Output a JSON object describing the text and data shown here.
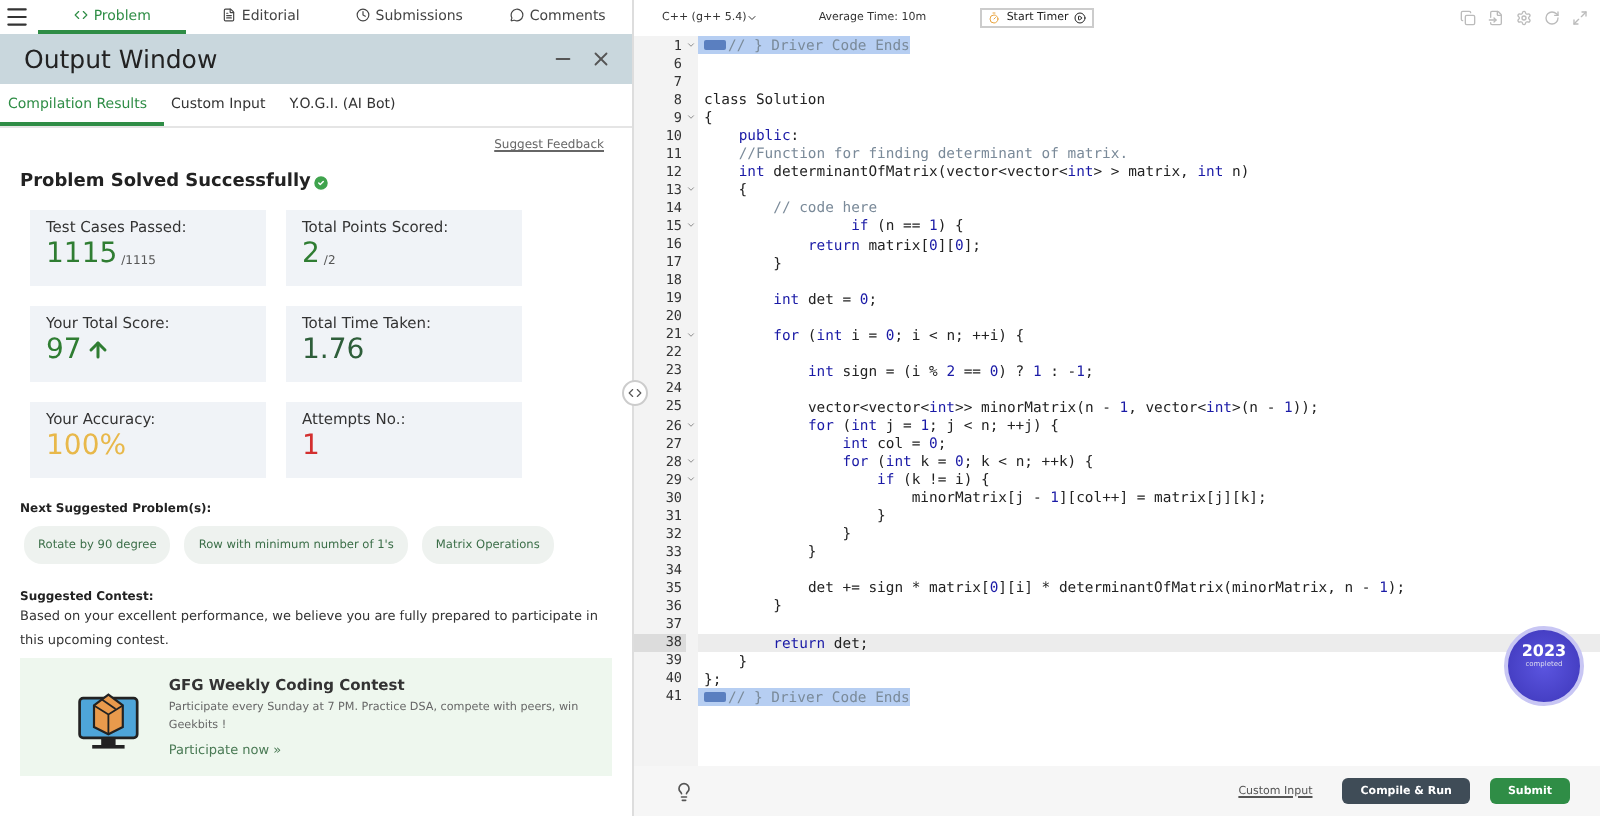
{
  "nav_tabs": [
    {
      "label": "Problem",
      "selected": true
    },
    {
      "label": "Editorial",
      "selected": false
    },
    {
      "label": "Submissions",
      "selected": false
    },
    {
      "label": "Comments",
      "selected": false
    }
  ],
  "output_window": {
    "title": "Output Window",
    "tabs": [
      {
        "label": "Compilation Results",
        "selected": true
      },
      {
        "label": "Custom Input",
        "selected": false
      },
      {
        "label": "Y.O.G.I. (AI Bot)",
        "selected": false
      }
    ],
    "feedback_link": "Suggest Feedback",
    "status": "Problem Solved Successfully",
    "stats": [
      {
        "label": "Test Cases Passed:",
        "value": "1115",
        "suffix": "/1115",
        "color": "#2f7d32",
        "rising": false
      },
      {
        "label": "Total Points Scored:",
        "value": "2",
        "suffix": "/2",
        "color": "#2f7d32",
        "rising": false
      },
      {
        "label": "Your Total Score:",
        "value": "97",
        "color": "#2f7d32",
        "rising": true
      },
      {
        "label": "Total Time Taken:",
        "value": "1.76",
        "color": "#2e5e3a",
        "rising": false
      },
      {
        "label": "Your Accuracy:",
        "value": "100%",
        "color": "#e8b84a",
        "rising": false
      },
      {
        "label": "Attempts No.:",
        "value": "1",
        "color": "#d32f2f",
        "rising": false
      }
    ],
    "suggested_heading": "Next Suggested Problem(s):",
    "suggested_problems": [
      "Rotate by 90 degree",
      "Row with minimum number of 1's",
      "Matrix Operations"
    ],
    "contest_heading": "Suggested Contest:",
    "contest_text": "Based on your excellent performance, we believe you are fully prepared to participate in this upcoming contest.",
    "contest": {
      "title": "GFG Weekly Coding Contest",
      "description": "Participate every Sunday at 7 PM. Practice DSA, compete with peers, win Geekbits !",
      "link": "Participate now »"
    }
  },
  "editor": {
    "language": "C++ (g++ 5.4)",
    "average_time": "Average Time: 10m",
    "timer_button": "Start Timer",
    "lines": [
      {
        "num": "1",
        "text": "// } Driver Code Ends",
        "fold": true,
        "folded": true,
        "selected": true,
        "current": false
      },
      {
        "num": "6",
        "fold": false,
        "folded": false,
        "selected": false,
        "current": false
      },
      {
        "num": "7",
        "fold": false,
        "folded": false,
        "selected": false,
        "current": false
      },
      {
        "num": "8",
        "text": "class Solution",
        "fold": false,
        "folded": false,
        "selected": false,
        "current": false
      },
      {
        "num": "9",
        "text": "{",
        "fold": true,
        "folded": false,
        "selected": false,
        "current": false
      },
      {
        "num": "10",
        "text": "    public:",
        "fold": false,
        "folded": false,
        "selected": false,
        "current": false
      },
      {
        "num": "11",
        "text": "    //Function for finding determinant of matrix.",
        "fold": false,
        "folded": false,
        "selected": false,
        "current": false
      },
      {
        "num": "12",
        "text": "    int determinantOfMatrix(vector<vector<int> > matrix, int n)",
        "fold": false,
        "folded": false,
        "selected": false,
        "current": false
      },
      {
        "num": "13",
        "text": "    {",
        "fold": true,
        "folded": false,
        "selected": false,
        "current": false
      },
      {
        "num": "14",
        "text": "        // code here",
        "fold": false,
        "folded": false,
        "selected": false,
        "current": false
      },
      {
        "num": "15",
        "text": "                 if (n == 1) {",
        "fold": true,
        "folded": false,
        "selected": false,
        "current": false
      },
      {
        "num": "16",
        "text": "            return matrix[0][0];",
        "fold": false,
        "folded": false,
        "selected": false,
        "current": false
      },
      {
        "num": "17",
        "text": "        }",
        "fold": false,
        "folded": false,
        "selected": false,
        "current": false
      },
      {
        "num": "18",
        "fold": false,
        "folded": false,
        "selected": false,
        "current": false
      },
      {
        "num": "19",
        "text": "        int det = 0;",
        "fold": false,
        "folded": false,
        "selected": false,
        "current": false
      },
      {
        "num": "20",
        "fold": false,
        "folded": false,
        "selected": false,
        "current": false
      },
      {
        "num": "21",
        "text": "        for (int i = 0; i < n; ++i) {",
        "fold": true,
        "folded": false,
        "selected": false,
        "current": false
      },
      {
        "num": "22",
        "fold": false,
        "folded": false,
        "selected": false,
        "current": false
      },
      {
        "num": "23",
        "text": "            int sign = (i % 2 == 0) ? 1 : -1;",
        "fold": false,
        "folded": false,
        "selected": false,
        "current": false
      },
      {
        "num": "24",
        "fold": false,
        "folded": false,
        "selected": false,
        "current": false
      },
      {
        "num": "25",
        "text": "            vector<vector<int>> minorMatrix(n - 1, vector<int>(n - 1));",
        "fold": false,
        "folded": false,
        "selected": false,
        "current": false
      },
      {
        "num": "26",
        "text": "            for (int j = 1; j < n; ++j) {",
        "fold": true,
        "folded": false,
        "selected": false,
        "current": false
      },
      {
        "num": "27",
        "text": "                int col = 0;",
        "fold": false,
        "folded": false,
        "selected": false,
        "current": false
      },
      {
        "num": "28",
        "text": "                for (int k = 0; k < n; ++k) {",
        "fold": true,
        "folded": false,
        "selected": false,
        "current": false
      },
      {
        "num": "29",
        "text": "                    if (k != i) {",
        "fold": true,
        "folded": false,
        "selected": false,
        "current": false
      },
      {
        "num": "30",
        "text": "                        minorMatrix[j - 1][col++] = matrix[j][k];",
        "fold": false,
        "folded": false,
        "selected": false,
        "current": false
      },
      {
        "num": "31",
        "text": "                    }",
        "fold": false,
        "folded": false,
        "selected": false,
        "current": false
      },
      {
        "num": "32",
        "text": "                }",
        "fold": false,
        "folded": false,
        "selected": false,
        "current": false
      },
      {
        "num": "33",
        "text": "            }",
        "fold": false,
        "folded": false,
        "selected": false,
        "current": false
      },
      {
        "num": "34",
        "fold": false,
        "folded": false,
        "selected": false,
        "current": false
      },
      {
        "num": "35",
        "text": "            det += sign * matrix[0][i] * determinantOfMatrix(minorMatrix, n - 1);",
        "fold": false,
        "folded": false,
        "selected": false,
        "current": false
      },
      {
        "num": "36",
        "text": "        }",
        "fold": false,
        "folded": false,
        "selected": false,
        "current": false
      },
      {
        "num": "37",
        "fold": false,
        "folded": false,
        "selected": false,
        "current": false
      },
      {
        "num": "38",
        "text": "        return det;",
        "fold": false,
        "folded": false,
        "selected": false,
        "current": true
      },
      {
        "num": "39",
        "text": "    }",
        "fold": false,
        "folded": false,
        "selected": false,
        "current": false
      },
      {
        "num": "40",
        "text": "};",
        "fold": false,
        "folded": false,
        "selected": false,
        "current": false
      },
      {
        "num": "41",
        "text": "// } Driver Code Ends",
        "fold": false,
        "folded": true,
        "selected": true,
        "current": false
      }
    ],
    "badge": {
      "year": "2023",
      "caption": "completed"
    },
    "custom_input_link": "Custom Input",
    "run_button": "Compile & Run",
    "submit_button": "Submit"
  }
}
